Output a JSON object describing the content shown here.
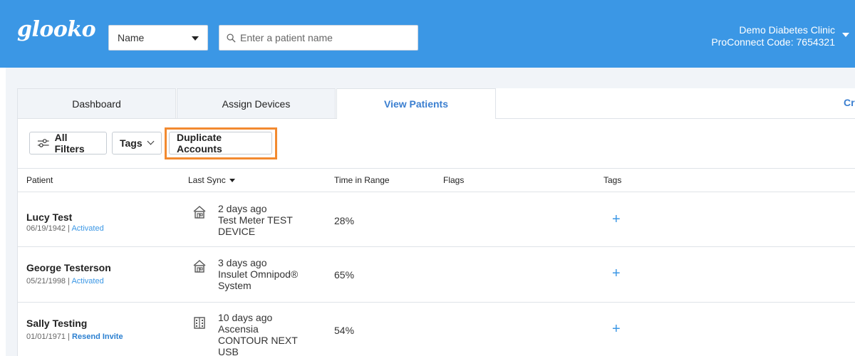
{
  "header": {
    "logo": "glooko",
    "search_type": "Name",
    "search_placeholder": "Enter a patient name",
    "clinic_name": "Demo Diabetes Clinic",
    "proconnect_code": "ProConnect Code: 7654321"
  },
  "tabs": [
    {
      "label": "Dashboard",
      "active": false
    },
    {
      "label": "Assign Devices",
      "active": false
    },
    {
      "label": "View Patients",
      "active": true
    }
  ],
  "right_link_partial": "Cr",
  "toolbar": {
    "filters_label": "All Filters",
    "tags_label": "Tags",
    "duplicate_label": "Duplicate Accounts"
  },
  "table": {
    "columns": [
      "Patient",
      "Last Sync",
      "Time in Range",
      "Flags",
      "Tags"
    ],
    "rows": [
      {
        "name": "Lucy Test",
        "dob": "06/19/1942",
        "status": "Activated",
        "sync_time": "2 days ago",
        "device": "Test Meter TEST DEVICE",
        "location_icon": "home-icon",
        "time_in_range": "28%",
        "tags_action": "+"
      },
      {
        "name": "George Testerson",
        "dob": "05/21/1998",
        "status": "Activated",
        "sync_time": "3 days ago",
        "device": "Insulet Omnipod® System",
        "location_icon": "home-icon",
        "time_in_range": "65%",
        "tags_action": "+"
      },
      {
        "name": "Sally Testing",
        "dob": "01/01/1971",
        "status": "Resend Invite",
        "sync_time": "10 days ago",
        "device": "Ascensia CONTOUR NEXT USB",
        "location_icon": "clinic-building-icon",
        "time_in_range": "54%",
        "tags_action": "+"
      }
    ]
  },
  "colors": {
    "header_blue": "#3b97e5",
    "link_blue": "#3b7fd0",
    "highlight_orange": "#f28a30",
    "content_bg": "#f1f4f8"
  }
}
